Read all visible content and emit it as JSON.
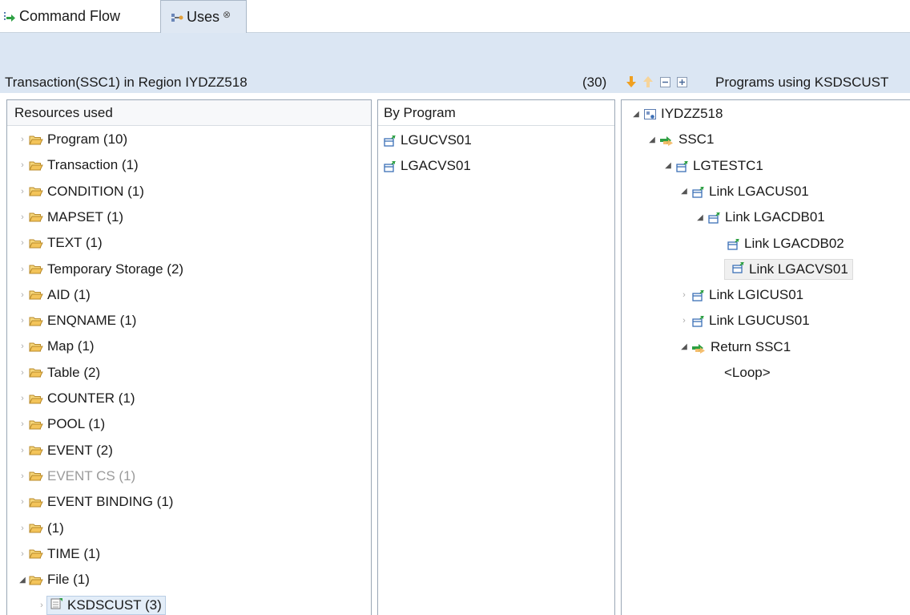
{
  "tabs": [
    {
      "label": "Command Flow",
      "icon": "command-flow-icon"
    },
    {
      "label": "Uses",
      "icon": "uses-icon",
      "close": "⊗"
    }
  ],
  "header": {
    "title": "Transaction(SSC1) in Region IYDZZ518",
    "count": "(30)",
    "programs_title": "Programs using KSDSCUST"
  },
  "resources": {
    "column_header": "Resources used",
    "items": [
      {
        "label": "Program",
        "count": "(10)"
      },
      {
        "label": "Transaction",
        "count": "(1)"
      },
      {
        "label": "CONDITION",
        "count": "(1)"
      },
      {
        "label": "MAPSET",
        "count": "(1)"
      },
      {
        "label": "TEXT",
        "count": "(1)"
      },
      {
        "label": "Temporary Storage",
        "count": "(2)"
      },
      {
        "label": "AID",
        "count": "(1)"
      },
      {
        "label": "ENQNAME",
        "count": "(1)"
      },
      {
        "label": "Map",
        "count": "(1)"
      },
      {
        "label": "Table",
        "count": "(2)"
      },
      {
        "label": "COUNTER",
        "count": "(1)"
      },
      {
        "label": "POOL",
        "count": "(1)"
      },
      {
        "label": "EVENT",
        "count": "(2)"
      },
      {
        "label": "EVENT CS",
        "count": "(1)"
      },
      {
        "label": "EVENT BINDING",
        "count": "(1)"
      },
      {
        "label": "",
        "count": "(1)"
      },
      {
        "label": "TIME",
        "count": "(1)"
      },
      {
        "label": "File",
        "count": "(1)"
      }
    ],
    "selected_child": "KSDSCUST (3)"
  },
  "by_program": {
    "column_header": "By Program",
    "items": [
      "LGUCVS01",
      "LGACVS01"
    ]
  },
  "tree": {
    "nodes": [
      {
        "label": "IYDZZ518"
      },
      {
        "label": "SSC1"
      },
      {
        "label": "LGTESTC1"
      },
      {
        "label": "Link LGACUS01"
      },
      {
        "label": "Link LGACDB01"
      },
      {
        "label": "Link LGACDB02"
      },
      {
        "label": "Link LGACVS01"
      },
      {
        "label": "Link LGICUS01"
      },
      {
        "label": "Link LGUCUS01"
      },
      {
        "label": "Return SSC1"
      },
      {
        "label": "<Loop>"
      }
    ]
  },
  "colors": {
    "band": "#dbe6f3",
    "folder": "#e6b84a",
    "green_arrow": "#2ea043",
    "blue_frame": "#3b6fb6",
    "toolbar_arrow": "#f0a020"
  }
}
